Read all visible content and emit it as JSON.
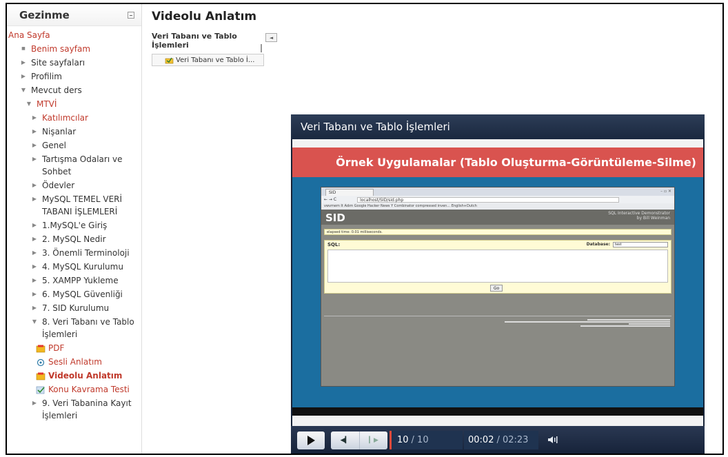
{
  "sidebar": {
    "title": "Gezinme",
    "items": [
      {
        "label": "Ana Sayfa",
        "indent": 0,
        "icon": "none",
        "style": "lnk"
      },
      {
        "label": "Benim sayfam",
        "indent": 1,
        "icon": "bullet",
        "style": "lnk"
      },
      {
        "label": "Site sayfaları",
        "indent": 1,
        "icon": "right",
        "style": "dark"
      },
      {
        "label": "Profilim",
        "indent": 1,
        "icon": "right",
        "style": "dark"
      },
      {
        "label": "Mevcut ders",
        "indent": 1,
        "icon": "down",
        "style": "dark"
      },
      {
        "label": "MTVİ",
        "indent": 2,
        "icon": "down",
        "style": "lnk"
      },
      {
        "label": "Katılımcılar",
        "indent": 3,
        "icon": "right",
        "style": "lnk"
      },
      {
        "label": "Nişanlar",
        "indent": 3,
        "icon": "right",
        "style": "dark"
      },
      {
        "label": "Genel",
        "indent": 3,
        "icon": "right",
        "style": "dark"
      },
      {
        "label": "Tartışma Odaları ve Sohbet",
        "indent": 3,
        "icon": "right",
        "style": "dark"
      },
      {
        "label": "Ödevler",
        "indent": 3,
        "icon": "right",
        "style": "dark"
      },
      {
        "label": "MySQL TEMEL VERİ TABANI İŞLEMLERİ",
        "indent": 3,
        "icon": "right",
        "style": "dark"
      },
      {
        "label": "1.MySQL'e Giriş",
        "indent": 3,
        "icon": "right",
        "style": "dark"
      },
      {
        "label": "2. MySQL Nedir",
        "indent": 3,
        "icon": "right",
        "style": "dark"
      },
      {
        "label": "3. Önemli Terminoloji",
        "indent": 3,
        "icon": "right",
        "style": "dark"
      },
      {
        "label": "4. MySQL Kurulumu",
        "indent": 3,
        "icon": "right",
        "style": "dark"
      },
      {
        "label": "5. XAMPP Yukleme",
        "indent": 3,
        "icon": "right",
        "style": "dark"
      },
      {
        "label": "6. MySQL Güvenliği",
        "indent": 3,
        "icon": "right",
        "style": "dark"
      },
      {
        "label": "7. SID Kurulumu",
        "indent": 3,
        "icon": "right",
        "style": "dark"
      },
      {
        "label": "8. Veri Tabanı ve Tablo İşlemleri",
        "indent": 3,
        "icon": "down",
        "style": "dark"
      },
      {
        "label": "PDF",
        "indent": 4,
        "icon": "pdf",
        "style": "lnk"
      },
      {
        "label": "Sesli Anlatım",
        "indent": 4,
        "icon": "audio",
        "style": "lnk"
      },
      {
        "label": "Videolu Anlatım",
        "indent": 4,
        "icon": "video",
        "style": "active"
      },
      {
        "label": "Konu Kavrama Testi",
        "indent": 4,
        "icon": "quiz",
        "style": "lnk"
      },
      {
        "label": "9. Veri Tabanina Kayıt İşlemleri",
        "indent": 3,
        "icon": "right",
        "style": "dark"
      }
    ]
  },
  "main": {
    "title": "Videolu Anlatım",
    "block_title": "Veri Tabanı ve Tablo İşlemleri",
    "block_item": "Veri Tabanı ve Tablo İ..."
  },
  "player": {
    "title": "Veri Tabanı ve Tablo İşlemleri",
    "slide_heading": "Örnek Uygulamalar (Tablo Oluşturma-Görüntüleme-Silme)",
    "slide_current": "10",
    "slide_total": "/ 10",
    "time_current": "00:02",
    "time_total": "/ 02:23",
    "browser": {
      "tab": "SID",
      "url": "localhost/SID/sid.php",
      "bookmarks": "vwvmem   It Adım   Google   Hacker News   Y Combinator   compressed inven...   English+Dutch",
      "logo": "SID",
      "subtitle_1": "SQL Interactive Demonstrator",
      "subtitle_2": "by Bill Weinman",
      "elapsed": "elapsed time: 0.01 milliseconds.",
      "sql_label": "SQL:",
      "db_label": "Database:",
      "db_value": "test",
      "go": "Go"
    }
  },
  "colors": {
    "link": "#c0392b",
    "slide_band": "#d9534f",
    "slide_body": "#1b6ea0",
    "player_bg": "#162236",
    "slide_marker": "#e24a3b"
  }
}
